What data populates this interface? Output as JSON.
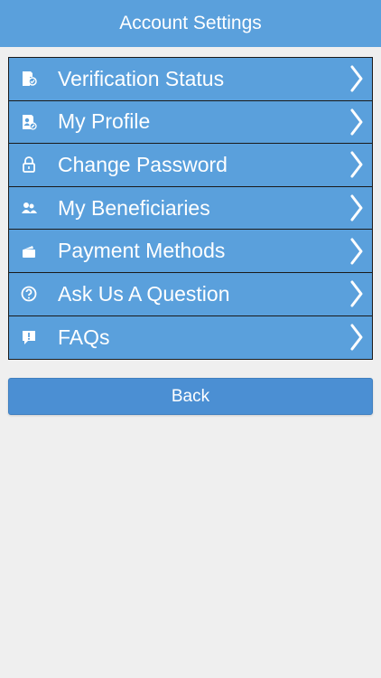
{
  "header": {
    "title": "Account Settings"
  },
  "menu": {
    "items": [
      {
        "label": "Verification Status",
        "icon": "verification-icon"
      },
      {
        "label": "My Profile",
        "icon": "profile-icon"
      },
      {
        "label": "Change Password",
        "icon": "lock-icon"
      },
      {
        "label": "My Beneficiaries",
        "icon": "beneficiaries-icon"
      },
      {
        "label": "Payment Methods",
        "icon": "wallet-icon"
      },
      {
        "label": "Ask Us A Question",
        "icon": "question-icon"
      },
      {
        "label": "FAQs",
        "icon": "faq-icon"
      }
    ]
  },
  "back": {
    "label": "Back"
  },
  "colors": {
    "accent": "#5aa0dc",
    "button": "#4b8fd3",
    "background": "#efefef"
  }
}
